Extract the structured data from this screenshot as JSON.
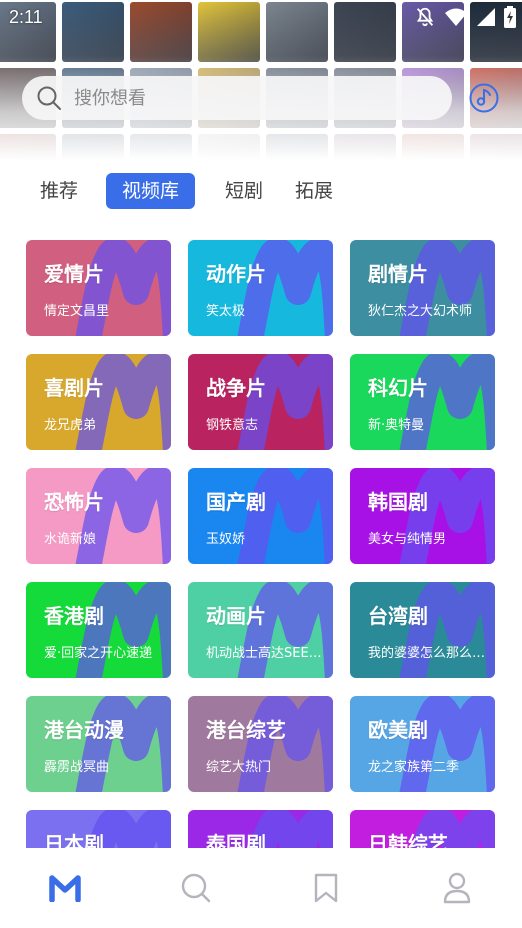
{
  "status_bar": {
    "time": "2:11",
    "icons": [
      "notifications-off-icon",
      "wifi-icon",
      "signal-icon",
      "battery-icon"
    ]
  },
  "header": {
    "poster_colors": [
      "#6b7a8c",
      "#3a5c7c",
      "#9c4a2e",
      "#e3c53a",
      "#7c8690",
      "#3b4452",
      "#6a5aa8",
      "#1c2a3a",
      "#2a3b55",
      "#4b3a3a",
      "#2b4c6e",
      "#7a8aa0",
      "#c9a240",
      "#5a6778",
      "#5e6a7a",
      "#a26fd0",
      "#c03a2a",
      "#3d4a5a",
      "#8a2e2e",
      "#2e3c50",
      "#4a5a6e",
      "#b4b4b4",
      "#46526a",
      "#6d4e68",
      "#a84038",
      "#7a3a4a",
      "#52607a"
    ],
    "search": {
      "placeholder": "搜你想看"
    },
    "music_icon": "music-disc-icon"
  },
  "tabs": [
    {
      "label": "推荐",
      "active": false
    },
    {
      "label": "视频库",
      "active": true
    },
    {
      "label": "短剧",
      "active": false
    },
    {
      "label": "拓展",
      "active": false
    }
  ],
  "categories": [
    {
      "title": "爱情片",
      "subtitle": "情定文昌里",
      "color": "#d15f7f"
    },
    {
      "title": "动作片",
      "subtitle": "笑太极",
      "color": "#17b8de"
    },
    {
      "title": "剧情片",
      "subtitle": "狄仁杰之大幻术师",
      "color": "#3c8ea0"
    },
    {
      "title": "喜剧片",
      "subtitle": "龙兄虎弟",
      "color": "#d8a82c"
    },
    {
      "title": "战争片",
      "subtitle": "钢铁意志",
      "color": "#b82360"
    },
    {
      "title": "科幻片",
      "subtitle": "新·奥特曼",
      "color": "#1ad85c"
    },
    {
      "title": "恐怖片",
      "subtitle": "水诡新娘",
      "color": "#f49ac4"
    },
    {
      "title": "国产剧",
      "subtitle": "玉奴娇",
      "color": "#1a86ef"
    },
    {
      "title": "韩国剧",
      "subtitle": "美女与纯情男",
      "color": "#a811e6"
    },
    {
      "title": "香港剧",
      "subtitle": "爱·回家之开心速递",
      "color": "#14db3a"
    },
    {
      "title": "动画片",
      "subtitle": "机动战士高达SEE…",
      "color": "#4fd0a4"
    },
    {
      "title": "台湾剧",
      "subtitle": "我的婆婆怎么那么…",
      "color": "#2a8a98"
    },
    {
      "title": "港台动漫",
      "subtitle": "霹雳战冥曲",
      "color": "#6ed08e"
    },
    {
      "title": "港台综艺",
      "subtitle": "综艺大热门",
      "color": "#a07a9e"
    },
    {
      "title": "欧美剧",
      "subtitle": "龙之家族第二季",
      "color": "#56a6e6"
    },
    {
      "title": "日本剧",
      "subtitle": "",
      "color": "#7a70f0"
    },
    {
      "title": "泰国剧",
      "subtitle": "",
      "color": "#9a28e6"
    },
    {
      "title": "日韩综艺",
      "subtitle": "",
      "color": "#c21ee0"
    }
  ],
  "bottom_nav": [
    {
      "name": "home",
      "icon": "m-logo-icon",
      "active": true
    },
    {
      "name": "search",
      "icon": "search-icon",
      "active": false
    },
    {
      "name": "bookmarks",
      "icon": "bookmark-icon",
      "active": false
    },
    {
      "name": "profile",
      "icon": "user-icon",
      "active": false
    }
  ],
  "accent_color": "#3a6ee8"
}
